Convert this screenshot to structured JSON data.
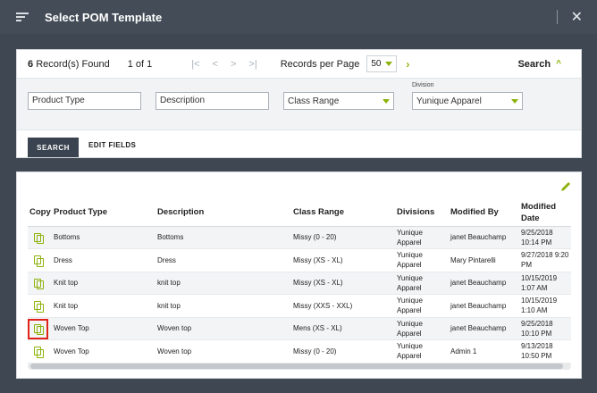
{
  "window": {
    "title": "Select POM Template"
  },
  "toolbar": {
    "record_count": "6",
    "record_label": "Record(s) Found",
    "page_of": "1 of 1",
    "pager": [
      "|<",
      "<",
      ">",
      ">|"
    ],
    "records_per_page_label": "Records per Page",
    "records_per_page_value": "50",
    "search_toggle": "Search"
  },
  "filters": {
    "product_type_placeholder": "Product Type",
    "description_placeholder": "Description",
    "class_range_value": "Class Range",
    "division_label": "Division",
    "division_value": "Yunique Apparel"
  },
  "actions": {
    "search": "SEARCH",
    "edit_fields": "EDIT FIELDS"
  },
  "table": {
    "headers": [
      "Copy",
      "Product Type",
      "Description",
      "Class Range",
      "Divisions",
      "Modified By",
      "Modified Date"
    ],
    "rows": [
      {
        "product_type": "Bottoms",
        "description": "Bottoms",
        "class_range": "Missy (0 - 20)",
        "division": "Yunique Apparel",
        "modified_by": "janet Beauchamp",
        "modified_date": "9/25/2018 10:14 PM"
      },
      {
        "product_type": "Dress",
        "description": "Dress",
        "class_range": "Missy (XS - XL)",
        "division": "Yunique Apparel",
        "modified_by": "Mary Pintarelli",
        "modified_date": "9/27/2018 9:20 PM"
      },
      {
        "product_type": "Knit top",
        "description": "knit top",
        "class_range": "Missy (XS - XL)",
        "division": "Yunique Apparel",
        "modified_by": "janet Beauchamp",
        "modified_date": "10/15/2019 1:07 AM"
      },
      {
        "product_type": "Knit top",
        "description": "knit top",
        "class_range": "Missy (XXS - XXL)",
        "division": "Yunique Apparel",
        "modified_by": "janet Beauchamp",
        "modified_date": "10/15/2019 1:10 AM"
      },
      {
        "product_type": "Woven Top",
        "description": "Woven top",
        "class_range": "Mens (XS - XL)",
        "division": "Yunique Apparel",
        "modified_by": "janet Beauchamp",
        "modified_date": "9/25/2018 10:10 PM"
      },
      {
        "product_type": "Woven Top",
        "description": "Woven top",
        "class_range": "Missy (0 - 20)",
        "division": "Yunique Apparel",
        "modified_by": "Admin 1",
        "modified_date": "9/13/2018 10:50 PM"
      }
    ]
  },
  "colors": {
    "accent": "#8cb20a",
    "header_bg": "#434c57",
    "highlight": "#e0241b"
  }
}
